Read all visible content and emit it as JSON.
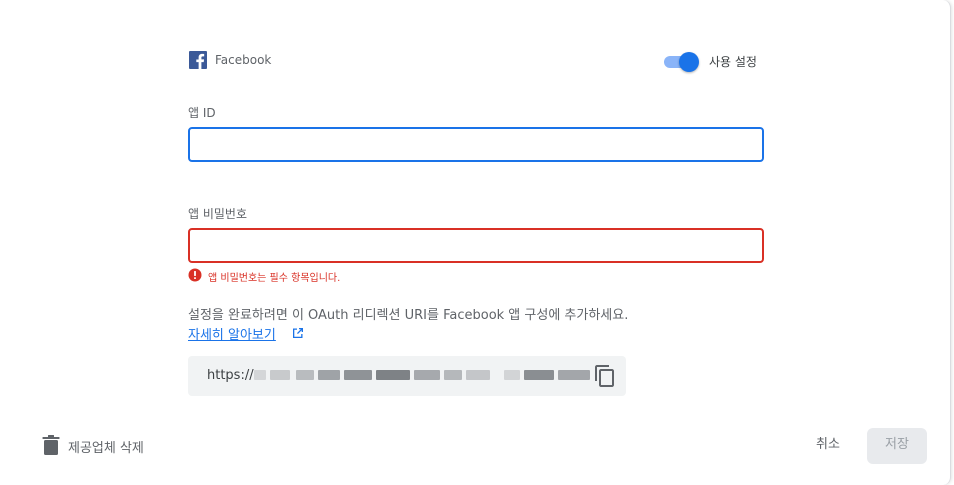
{
  "provider": {
    "icon": "facebook-icon",
    "name": "Facebook",
    "enabled": true,
    "toggle_label": "사용 설정"
  },
  "app_id": {
    "label": "앱 ID",
    "value": ""
  },
  "app_secret": {
    "label": "앱 비밀번호",
    "value": "",
    "error": "앱 비밀번호는 필수 항목입니다."
  },
  "info": {
    "text": "설정을 완료하려면 이 OAuth 리디렉션 URI를 Facebook 앱 구성에 추가하세요.",
    "learn_more": "자세히 알아보기",
    "learn_more_icon": "open-in-new-icon"
  },
  "redirect_uri": {
    "prefix": "https://",
    "copy_icon": "copy-icon"
  },
  "footer": {
    "delete_icon": "trash-icon",
    "delete_label": "제공업체 삭제",
    "cancel_label": "취소",
    "save_label": "저장"
  },
  "colors": {
    "accent": "#1a73e8",
    "error": "#d93025",
    "facebook": "#3b5998"
  }
}
